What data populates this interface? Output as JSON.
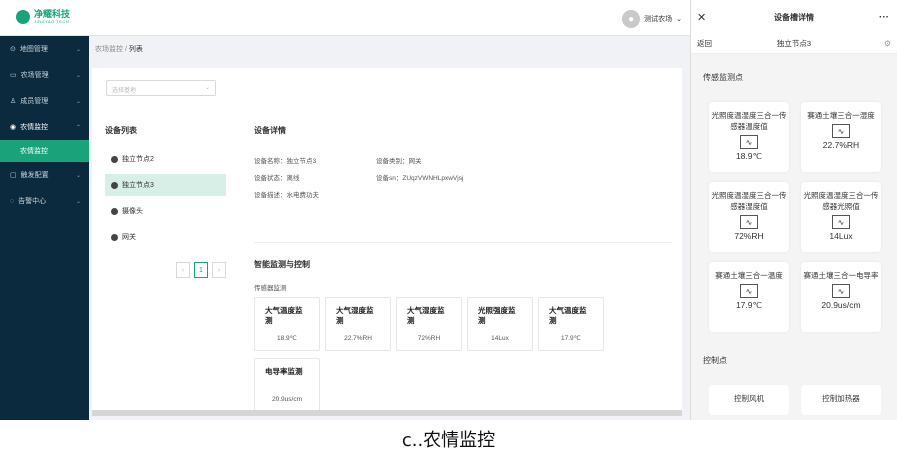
{
  "app": {
    "logo_text": "净耀科技",
    "logo_sub": "JINGYAO TECH",
    "user_name": "测试农场",
    "breadcrumb": {
      "parent": "农场监控",
      "sep": "/",
      "current": "列表"
    }
  },
  "sidebar": {
    "items": [
      {
        "label": "地图管理",
        "icon": "pin-icon"
      },
      {
        "label": "农场管理",
        "icon": "farm-icon"
      },
      {
        "label": "成员管理",
        "icon": "user-icon"
      },
      {
        "label": "农情监控",
        "icon": "monitor-icon",
        "open": true
      },
      {
        "label": "触发配置",
        "icon": "trigger-icon"
      },
      {
        "label": "告警中心",
        "icon": "alarm-icon"
      }
    ],
    "sub_item": "农情监控"
  },
  "main": {
    "select_placeholder": "选择基地",
    "device_list_title": "设备列表",
    "devices": [
      {
        "label": "独立节点2"
      },
      {
        "label": "独立节点3",
        "active": true
      },
      {
        "label": "摄像头"
      },
      {
        "label": "网关"
      }
    ],
    "pager": {
      "prev": "‹",
      "page": "1",
      "next": "›"
    },
    "detail_title": "设备详情",
    "detail": {
      "name": "设备名称：独立节点3",
      "type": "设备类别：网关",
      "status": "设备状态：离线",
      "sn": "设备sn：ZUqzVWNHLpxwVjsj",
      "desc": "设备描述：水电费功夫"
    },
    "monitor_title": "智能监测与控制",
    "sensor_label": "传感器监测",
    "cards": [
      {
        "title": "大气温度监测",
        "value": "18.9℃"
      },
      {
        "title": "大气湿度监测",
        "value": "22.7%RH"
      },
      {
        "title": "大气湿度监测",
        "value": "72%RH"
      },
      {
        "title": "光照强度监测",
        "value": "14Lux"
      },
      {
        "title": "大气温度监测",
        "value": "17.9℃"
      },
      {
        "title": "电导率监测",
        "value": "20.9us/cm"
      }
    ]
  },
  "panel": {
    "title": "设备槽详情",
    "close": "✕",
    "more": "···",
    "back": "返回",
    "node": "独立节点3",
    "gear": "⚙",
    "sensor_section": "传感监测点",
    "sensors": [
      {
        "name": "光照度温湿度三合一传感器温度值",
        "value": "18.9℃"
      },
      {
        "name": "赛通土壤三合一湿度",
        "value": "22.7%RH"
      },
      {
        "name": "光照度温湿度三合一传感器湿度值",
        "value": "72%RH"
      },
      {
        "name": "光照度温湿度三合一传感器光照值",
        "value": "14Lux"
      },
      {
        "name": "赛通土壤三合一温度",
        "value": "17.9℃"
      },
      {
        "name": "赛通土壤三合一电导率",
        "value": "20.9us/cm"
      }
    ],
    "control_section": "控制点",
    "controls": [
      {
        "label": "控制风机"
      },
      {
        "label": "控制加热器"
      }
    ]
  },
  "caption": "c..农情监控"
}
